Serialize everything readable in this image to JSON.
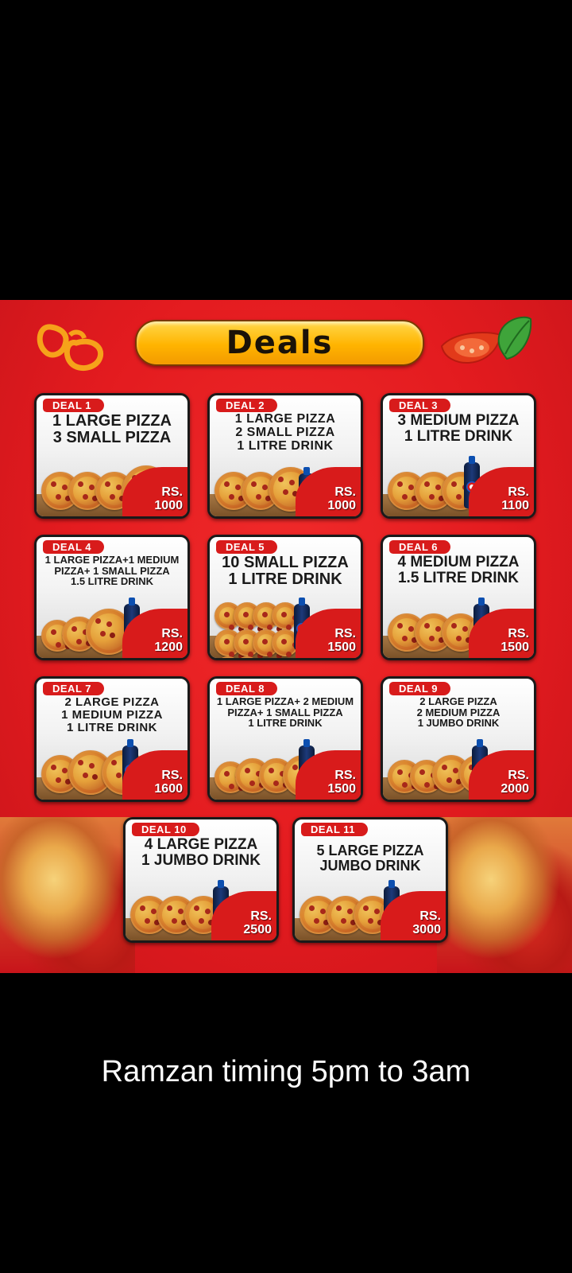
{
  "header": {
    "title": "Deals"
  },
  "deals": [
    {
      "badge": "DEAL 1",
      "lines": "1 LARGE PIZZA\n3 SMALL PIZZA",
      "currency": "RS.",
      "price": "1000"
    },
    {
      "badge": "DEAL 2",
      "lines": "1 LARGE PIZZA\n2 SMALL PIZZA\n1 LITRE DRINK",
      "currency": "RS.",
      "price": "1000"
    },
    {
      "badge": "DEAL 3",
      "lines": "3 MEDIUM PIZZA\n1 LITRE DRINK",
      "currency": "RS.",
      "price": "1100"
    },
    {
      "badge": "DEAL 4",
      "lines": "1 LARGE PIZZA+1 MEDIUM\nPIZZA+ 1 SMALL PIZZA\n1.5 LITRE DRINK",
      "currency": "RS.",
      "price": "1200"
    },
    {
      "badge": "DEAL 5",
      "lines": "10 SMALL PIZZA\n1 LITRE DRINK",
      "currency": "RS.",
      "price": "1500"
    },
    {
      "badge": "DEAL 6",
      "lines": "4 MEDIUM PIZZA\n1.5 LITRE DRINK",
      "currency": "RS.",
      "price": "1500"
    },
    {
      "badge": "DEAL 7",
      "lines": "2 LARGE PIZZA\n1 MEDIUM PIZZA\n1 LITRE DRINK",
      "currency": "RS.",
      "price": "1600"
    },
    {
      "badge": "DEAL 8",
      "lines": "1 LARGE PIZZA+ 2 MEDIUM\nPIZZA+ 1 SMALL PIZZA\n1 LITRE DRINK",
      "currency": "RS.",
      "price": "1500"
    },
    {
      "badge": "DEAL 9",
      "lines": "2 LARGE PIZZA\n2 MEDIUM PIZZA\n1 JUMBO DRINK",
      "currency": "RS.",
      "price": "2000"
    },
    {
      "badge": "DEAL 10",
      "lines": "4 LARGE PIZZA\n1 JUMBO DRINK",
      "currency": "RS.",
      "price": "2500"
    },
    {
      "badge": "DEAL 11",
      "lines": "5 LARGE PIZZA\nJUMBO DRINK",
      "currency": "RS.",
      "price": "3000"
    }
  ],
  "caption": "Ramzan timing 5pm to 3am"
}
